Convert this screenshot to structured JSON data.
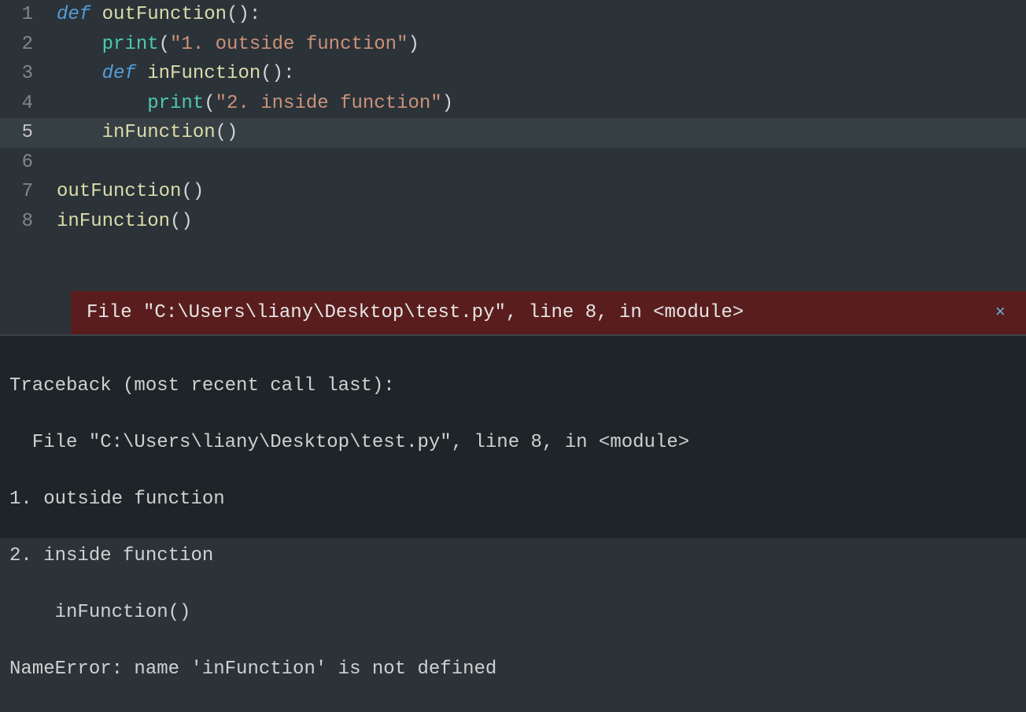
{
  "editor": {
    "linenumbers": [
      "1",
      "2",
      "3",
      "4",
      "5",
      "6",
      "7",
      "8"
    ],
    "line1": {
      "kw": "def",
      "name": "outFunction",
      "parens": "():"
    },
    "line2": {
      "indent": "    ",
      "builtin": "print",
      "open": "(",
      "str": "\"1. outside function\"",
      "close": ")"
    },
    "line3": {
      "indent": "    ",
      "kw": "def",
      "name": "inFunction",
      "parens": "():"
    },
    "line4": {
      "indent": "        ",
      "builtin": "print",
      "open": "(",
      "str": "\"2. inside function\"",
      "close": ")"
    },
    "line5": {
      "indent": "    ",
      "name": "inFunction",
      "parens": "()"
    },
    "line6": "",
    "line7": {
      "name": "outFunction",
      "parens": "()"
    },
    "line8": {
      "name": "inFunction",
      "parens": "()"
    }
  },
  "error_banner": {
    "text": "File \"C:\\Users\\liany\\Desktop\\test.py\", line 8, in <module>",
    "close": "×"
  },
  "terminal": {
    "line1": "Traceback (most recent call last):",
    "line2": "  File \"C:\\Users\\liany\\Desktop\\test.py\", line 8, in <module>",
    "line3": "1. outside function",
    "line4": "2. inside function",
    "line5": "    inFunction()",
    "line6": "NameError: name 'inFunction' is not defined"
  }
}
